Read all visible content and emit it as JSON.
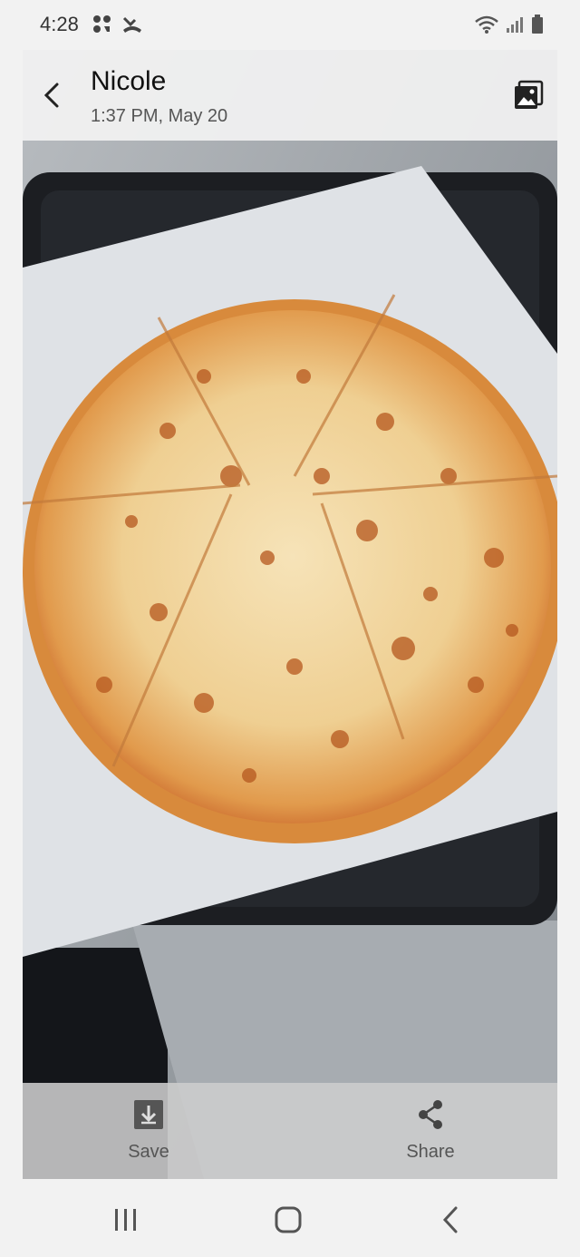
{
  "status_bar": {
    "time": "4:28",
    "left_icons": [
      "notification-dots-icon",
      "missed-call-icon"
    ],
    "right_icons": [
      "wifi-icon",
      "signal-icon",
      "battery-icon"
    ]
  },
  "header": {
    "sender": "Nicole",
    "datetime": "1:37 PM, May 20",
    "back_icon": "chevron-left-icon",
    "gallery_icon": "gallery-icon"
  },
  "photo": {
    "subject": "cheese pizza",
    "colors": {
      "crust": "#d88a3c",
      "cheese": "#f2d8a6",
      "sauce": "#c9501f",
      "tray": "#1c1e22",
      "paper": "#dfe2e6",
      "table": "#9aa0a6"
    }
  },
  "footer": {
    "save_label": "Save",
    "share_label": "Share"
  },
  "nav_bar": {
    "recents_icon": "recents-icon",
    "home_icon": "home-icon",
    "back_icon": "back-icon"
  }
}
